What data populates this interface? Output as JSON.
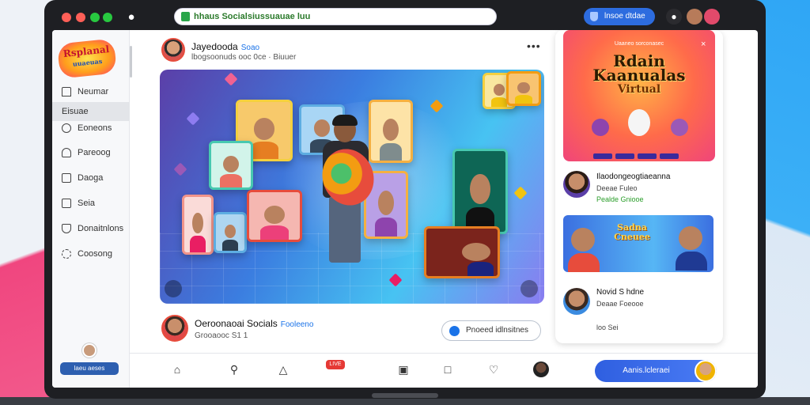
{
  "browser": {
    "url": "hhaus Socialsiussuauae luu",
    "shield_button": "lnsoe dtdae"
  },
  "sidebar": {
    "logo_main": "Rsplanal",
    "logo_sub": "uuaeuas",
    "items": [
      {
        "label": "Neumar",
        "icon": "home-icon"
      },
      {
        "label": "Eisuae",
        "icon": "",
        "active": true
      },
      {
        "label": "Eoneons",
        "icon": "chat-icon"
      },
      {
        "label": "Pareoog",
        "icon": "bell-icon"
      },
      {
        "label": "Daoga",
        "icon": "image-icon"
      },
      {
        "label": "Seia",
        "icon": "square-icon"
      },
      {
        "label": "Donaitnlons",
        "icon": "bookmark-icon"
      },
      {
        "label": "Coosong",
        "icon": "settings-icon"
      }
    ],
    "footer_button": "laeu aeses"
  },
  "post": {
    "author": "Jayedooda",
    "author_tag": "Soao",
    "meta": "lbogsoonuds ooc 0ce · Biuuer"
  },
  "post_footer": {
    "author": "Oeroonaoai Socials",
    "author_tag": "Fooleeno",
    "meta": "Grooaooc S1 1",
    "pill_label": "Pnoeed idlnsitnes"
  },
  "bottombar": {
    "live_badge": "LIVE",
    "cta_label": "Aanis.lcleraei"
  },
  "right_panel": {
    "promo": {
      "kicker": "Uaaneo sorconasec",
      "title_line1": "Rdain",
      "title_line2": "Kaanualas",
      "title_line3": "Virtual",
      "close": "×"
    },
    "entry1": {
      "name": "Ilaodongeogtiaeanna",
      "sub": "Deeae Fuleo",
      "tag": "Pealde Gniooe"
    },
    "thumb_title": "Sadna Cneuee",
    "entry2": {
      "name": "Novid S hdne",
      "sub": "Deaae Foeooe",
      "extra": "loo Sei"
    }
  },
  "colors": {
    "accent": "#2d6cdf",
    "live": "#e53935",
    "promo": "#ff6b4a"
  }
}
